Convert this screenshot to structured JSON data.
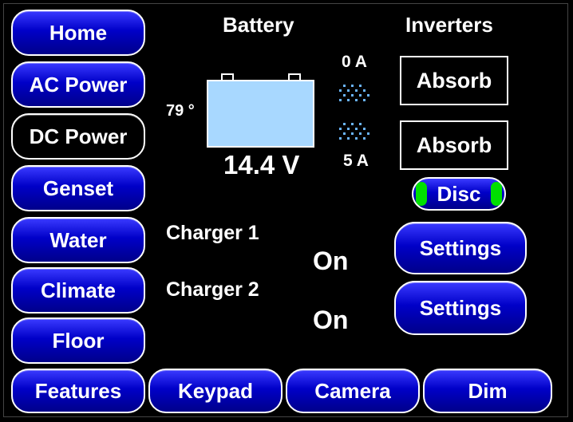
{
  "nav": {
    "items": [
      {
        "label": "Home"
      },
      {
        "label": "AC Power"
      },
      {
        "label": "DC Power"
      },
      {
        "label": "Genset"
      },
      {
        "label": "Water"
      },
      {
        "label": "Climate"
      },
      {
        "label": "Floor"
      }
    ],
    "selected": "DC Power"
  },
  "bottom_bar": {
    "items": [
      {
        "label": "Features"
      },
      {
        "label": "Keypad"
      },
      {
        "label": "Camera"
      },
      {
        "label": "Dim"
      }
    ]
  },
  "battery": {
    "title": "Battery",
    "temperature": "79 °",
    "voltage": "14.4 V",
    "current_top": "0 A",
    "current_bottom": "5 A",
    "fill_color": "#a8d8ff"
  },
  "inverters": {
    "title": "Inverters",
    "status_1": "Absorb",
    "status_2": "Absorb",
    "disc_label": "Disc",
    "disc_indicator_color": "#00e000"
  },
  "chargers": [
    {
      "label": "Charger 1",
      "state": "On",
      "settings_label": "Settings"
    },
    {
      "label": "Charger 2",
      "state": "On",
      "settings_label": "Settings"
    }
  ],
  "colors": {
    "button_top": "#3a3aff",
    "button_bottom": "#00008a",
    "background": "#000000",
    "dots": "#6ab4ff"
  }
}
